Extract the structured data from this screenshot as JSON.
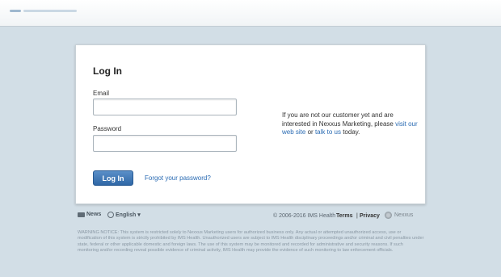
{
  "login": {
    "title": "Log In",
    "email_label": "Email",
    "email_value": "",
    "password_label": "Password",
    "password_value": "",
    "submit_label": "Log In",
    "forgot_link": "Forgot your password?"
  },
  "side": {
    "text_1": "If you are not our customer yet and are interested in Nexxus Marketing, please",
    "link_web": "visit our web site",
    "or": "or",
    "link_talk": "talk to us",
    "today": "today."
  },
  "footer": {
    "news": "News",
    "language": "English",
    "language_caret": "▾",
    "copyright": "© 2006-2016 IMS Health",
    "terms": "Terms",
    "sep": "|",
    "privacy": "Privacy",
    "nexus_label": "Nexxus"
  },
  "warning": "WARNING NOTICE: This system is restricted solely to Nexxus Marketing users for authorized business only. Any actual or attempted unauthorized access, use or modification of this system is strictly prohibited by IMS Health. Unauthorized users are subject to IMS Health disciplinary proceedings and/or criminal and civil penalties under state, federal or other applicable domestic and foreign laws. The use of this system may be monitored and recorded for administrative and security reasons. If such monitoring and/or recording reveal possible evidence of criminal activity, IMS Health may provide the evidence of such monitoring to law enforcement officials.",
  "icons": [
    "news-icon",
    "globe-icon",
    "nexus-logo-icon"
  ],
  "colors": {
    "accent": "#2f67a6",
    "link": "#2a6bb3",
    "background": "#d2dee6"
  }
}
